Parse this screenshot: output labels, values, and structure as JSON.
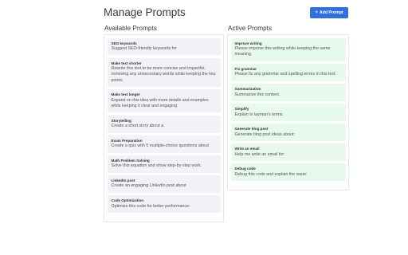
{
  "header": {
    "title": "Manage Prompts",
    "add_button": {
      "icon": "+",
      "label": "Add Prompt"
    }
  },
  "available": {
    "title": "Available Prompts",
    "items": [
      {
        "title": "SEO keywords",
        "desc": "Suggest SEO-friendly keywords for"
      },
      {
        "title": "Make text shorter",
        "desc": "Rewrite this text to be more concise and impactful, removing any unnecessary words while keeping the key points."
      },
      {
        "title": "Make text longer",
        "desc": "Expand on this idea with more details and examples while keeping it clear and engaging"
      },
      {
        "title": "Storytelling",
        "desc": "Create a short story about a"
      },
      {
        "title": "Exam Preparation",
        "desc": "Create a quiz with 5 multiple-choice questions about"
      },
      {
        "title": "Math Problem Solving",
        "desc": "Solve this equation and show step-by-step work."
      },
      {
        "title": "LinkedIn post",
        "desc": "Create an engaging LinkedIn post about"
      },
      {
        "title": "Code Optimization",
        "desc": "Optimize this code for better performance:"
      }
    ]
  },
  "active": {
    "title": "Active Prompts",
    "items": [
      {
        "title": "Improve writing",
        "desc": "Please improve this writing while keeping the same meaning."
      },
      {
        "title": "Fix grammar",
        "desc": "Please fix any grammar and spelling errors in this text."
      },
      {
        "title": "Summarization",
        "desc": "Summarize this content."
      },
      {
        "title": "Simplify",
        "desc": "Explain in layman's terms."
      },
      {
        "title": "Generate blog post",
        "desc": "Generate blog post ideas about:"
      },
      {
        "title": "Write an email",
        "desc": "Help me write an email for:"
      },
      {
        "title": "Debug code",
        "desc": "Debug this code and explain the issue:"
      }
    ]
  },
  "colors": {
    "accent": "#2f6fe0",
    "available_card": "#f1f2f5",
    "active_card": "#e7f8ec"
  }
}
